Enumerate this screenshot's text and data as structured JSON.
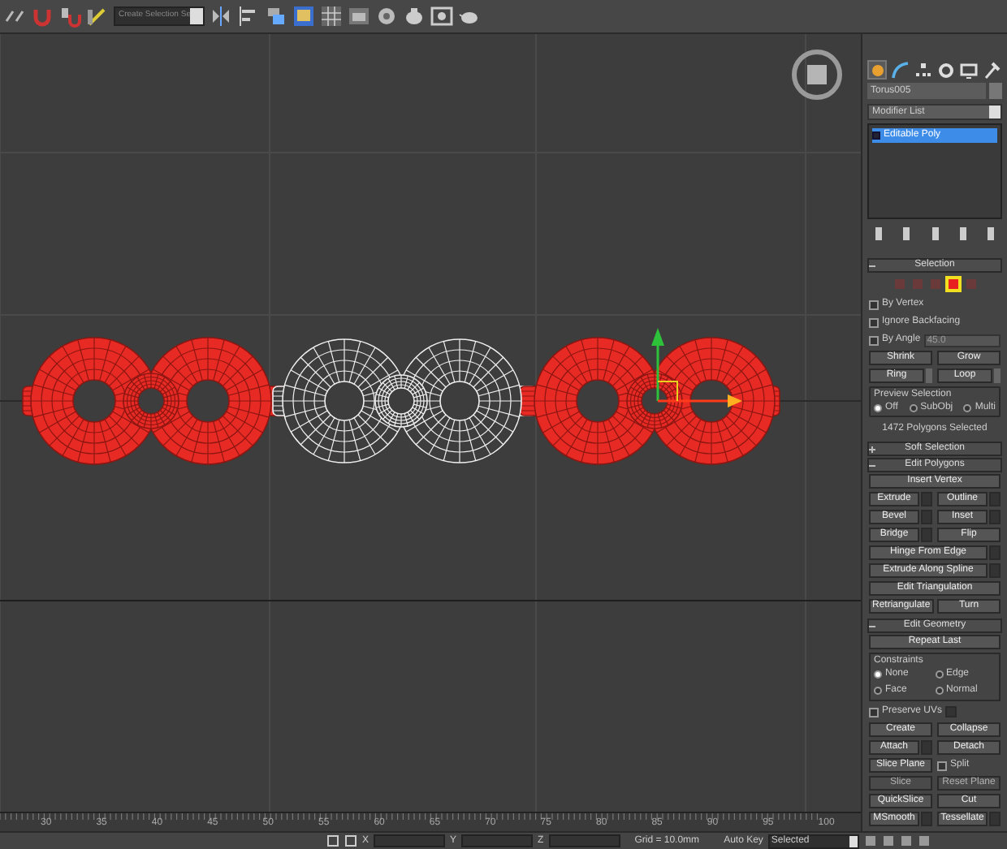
{
  "toolbar": {
    "selection_set": "Create Selection Se"
  },
  "command_panel": {
    "tabs": [
      {
        "selected": true
      },
      {
        "selected": false
      },
      {
        "selected": false
      },
      {
        "selected": false
      },
      {
        "selected": false
      },
      {
        "selected": false
      }
    ],
    "object_name": "Torus005",
    "modifier_list": "Modifier List",
    "stack": [
      {
        "label": "Editable Poly",
        "selected": true
      }
    ],
    "rollouts": [
      {
        "title": "Selection",
        "expanded": true,
        "rows": [
          {
            "kind": "levels",
            "levels": [
              {
                "selected": false
              },
              {
                "selected": false
              },
              {
                "selected": false
              },
              {
                "selected": true
              },
              {
                "selected": false
              }
            ]
          },
          {
            "kind": "check",
            "label": "By Vertex",
            "checked": false
          },
          {
            "kind": "check",
            "label": "Ignore Backfacing",
            "checked": false
          },
          {
            "kind": "check_spin",
            "label": "By Angle",
            "checked": false,
            "value": "45.0"
          },
          {
            "kind": "buttons",
            "buttons": [
              {
                "label": "Shrink"
              },
              {
                "label": "Grow"
              }
            ]
          },
          {
            "kind": "buttons",
            "buttons": [
              {
                "label": "Ring",
                "spinner": true
              },
              {
                "label": "Loop",
                "spinner": true
              }
            ]
          },
          {
            "kind": "radios",
            "title": "Preview Selection",
            "options": [
              {
                "label": "Off",
                "selected": true
              },
              {
                "label": "SubObj",
                "selected": false
              },
              {
                "label": "Multi",
                "selected": false
              }
            ]
          },
          {
            "kind": "note",
            "text": "1472 Polygons Selected"
          }
        ]
      },
      {
        "title": "Soft Selection",
        "expanded": false
      },
      {
        "title": "Edit Polygons",
        "expanded": true,
        "rows": [
          {
            "kind": "buttons",
            "buttons": [
              {
                "label": "Insert Vertex"
              }
            ]
          },
          {
            "kind": "buttons",
            "buttons": [
              {
                "label": "Extrude",
                "settings": true
              },
              {
                "label": "Outline",
                "settings": true
              }
            ]
          },
          {
            "kind": "buttons",
            "buttons": [
              {
                "label": "Bevel",
                "settings": true
              },
              {
                "label": "Inset",
                "settings": true
              }
            ]
          },
          {
            "kind": "buttons",
            "buttons": [
              {
                "label": "Bridge",
                "settings": true
              },
              {
                "label": "Flip"
              }
            ]
          },
          {
            "kind": "buttons",
            "buttons": [
              {
                "label": "Hinge From Edge",
                "settings": true
              }
            ]
          },
          {
            "kind": "buttons",
            "buttons": [
              {
                "label": "Extrude Along Spline",
                "settings": true
              }
            ]
          },
          {
            "kind": "buttons",
            "buttons": [
              {
                "label": "Edit Triangulation"
              }
            ]
          },
          {
            "kind": "buttons",
            "buttons": [
              {
                "label": "Retriangulate"
              },
              {
                "label": "Turn"
              }
            ]
          }
        ]
      },
      {
        "title": "Edit Geometry",
        "expanded": true,
        "rows": [
          {
            "kind": "buttons",
            "buttons": [
              {
                "label": "Repeat Last"
              }
            ]
          },
          {
            "kind": "group",
            "title": "Constraints",
            "options": [
              {
                "label": "None",
                "selected": true
              },
              {
                "label": "Edge",
                "selected": false
              },
              {
                "label": "Face",
                "selected": false
              },
              {
                "label": "Normal",
                "selected": false
              }
            ]
          },
          {
            "kind": "check",
            "label": "Preserve UVs",
            "checked": false,
            "settings": true
          },
          {
            "kind": "buttons",
            "buttons": [
              {
                "label": "Create"
              },
              {
                "label": "Collapse"
              }
            ]
          },
          {
            "kind": "buttons",
            "buttons": [
              {
                "label": "Attach",
                "settings": true
              },
              {
                "label": "Detach"
              }
            ]
          },
          {
            "kind": "slice",
            "button": "Slice Plane",
            "check": {
              "label": "Split",
              "checked": false
            }
          },
          {
            "kind": "buttons",
            "buttons": [
              {
                "label": "Slice",
                "disabled": true
              },
              {
                "label": "Reset Plane",
                "disabled": true
              }
            ]
          },
          {
            "kind": "buttons",
            "buttons": [
              {
                "label": "QuickSlice"
              },
              {
                "label": "Cut"
              }
            ]
          },
          {
            "kind": "buttons",
            "buttons": [
              {
                "label": "MSmooth",
                "settings": true
              },
              {
                "label": "Tessellate",
                "settings": true
              }
            ]
          }
        ]
      }
    ]
  },
  "timeline": {
    "ticks": [
      "30",
      "35",
      "40",
      "45",
      "50",
      "55",
      "60",
      "65",
      "70",
      "75",
      "80",
      "85",
      "90",
      "95",
      "100"
    ]
  },
  "status_bar": {
    "coords": [
      {
        "axis": "X"
      },
      {
        "axis": "Y"
      },
      {
        "axis": "Z"
      }
    ],
    "grid": "Grid = 10.0mm",
    "auto_key": "Auto Key",
    "key_filter": "Selected"
  }
}
